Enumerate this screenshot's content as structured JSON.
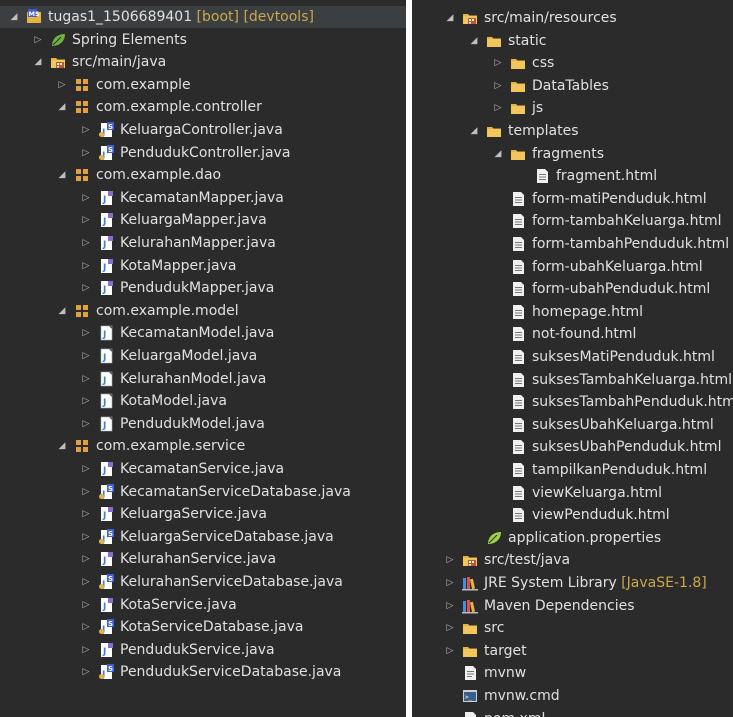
{
  "left_tree": [
    {
      "depth": 0,
      "expanded": true,
      "icon": "maven-project-icon",
      "label": "tugas1_1506689401",
      "decoration": " [boot] [devtools]",
      "row": 0
    },
    {
      "depth": 1,
      "expanded": false,
      "icon": "spring-leaf-icon",
      "label": "Spring Elements",
      "row": 1
    },
    {
      "depth": 1,
      "expanded": true,
      "icon": "source-folder-icon",
      "label": "src/main/java",
      "row": 2
    },
    {
      "depth": 2,
      "expanded": false,
      "icon": "package-icon",
      "label": "com.example",
      "row": 3
    },
    {
      "depth": 2,
      "expanded": true,
      "icon": "package-icon",
      "label": "com.example.controller",
      "row": 4
    },
    {
      "depth": 3,
      "expanded": false,
      "icon": "java-class-spring-icon",
      "label": "KeluargaController.java",
      "row": 5
    },
    {
      "depth": 3,
      "expanded": false,
      "icon": "java-class-spring-icon",
      "label": "PendudukController.java",
      "row": 6
    },
    {
      "depth": 2,
      "expanded": true,
      "icon": "package-icon",
      "label": "com.example.dao",
      "row": 7
    },
    {
      "depth": 3,
      "expanded": false,
      "icon": "java-interface-icon",
      "label": "KecamatanMapper.java",
      "row": 8
    },
    {
      "depth": 3,
      "expanded": false,
      "icon": "java-interface-icon",
      "label": "KeluargaMapper.java",
      "row": 9
    },
    {
      "depth": 3,
      "expanded": false,
      "icon": "java-interface-icon",
      "label": "KelurahanMapper.java",
      "row": 10
    },
    {
      "depth": 3,
      "expanded": false,
      "icon": "java-interface-icon",
      "label": "KotaMapper.java",
      "row": 11
    },
    {
      "depth": 3,
      "expanded": false,
      "icon": "java-interface-icon",
      "label": "PendudukMapper.java",
      "row": 12
    },
    {
      "depth": 2,
      "expanded": true,
      "icon": "package-icon",
      "label": "com.example.model",
      "row": 13
    },
    {
      "depth": 3,
      "expanded": false,
      "icon": "java-file-icon",
      "label": "KecamatanModel.java",
      "row": 14
    },
    {
      "depth": 3,
      "expanded": false,
      "icon": "java-file-icon",
      "label": "KeluargaModel.java",
      "row": 15
    },
    {
      "depth": 3,
      "expanded": false,
      "icon": "java-file-icon",
      "label": "KelurahanModel.java",
      "row": 16
    },
    {
      "depth": 3,
      "expanded": false,
      "icon": "java-file-icon",
      "label": "KotaModel.java",
      "row": 17
    },
    {
      "depth": 3,
      "expanded": false,
      "icon": "java-file-icon",
      "label": "PendudukModel.java",
      "row": 18
    },
    {
      "depth": 2,
      "expanded": true,
      "icon": "package-icon",
      "label": "com.example.service",
      "row": 19
    },
    {
      "depth": 3,
      "expanded": false,
      "icon": "java-interface-icon",
      "label": "KecamatanService.java",
      "row": 20
    },
    {
      "depth": 3,
      "expanded": false,
      "icon": "java-class-spring-icon",
      "label": "KecamatanServiceDatabase.java",
      "row": 21
    },
    {
      "depth": 3,
      "expanded": false,
      "icon": "java-interface-icon",
      "label": "KeluargaService.java",
      "row": 22
    },
    {
      "depth": 3,
      "expanded": false,
      "icon": "java-class-spring-icon",
      "label": "KeluargaServiceDatabase.java",
      "row": 23
    },
    {
      "depth": 3,
      "expanded": false,
      "icon": "java-interface-icon",
      "label": "KelurahanService.java",
      "row": 24
    },
    {
      "depth": 3,
      "expanded": false,
      "icon": "java-class-spring-icon",
      "label": "KelurahanServiceDatabase.java",
      "row": 25
    },
    {
      "depth": 3,
      "expanded": false,
      "icon": "java-interface-icon",
      "label": "KotaService.java",
      "row": 26
    },
    {
      "depth": 3,
      "expanded": false,
      "icon": "java-class-spring-icon",
      "label": "KotaServiceDatabase.java",
      "row": 27
    },
    {
      "depth": 3,
      "expanded": false,
      "icon": "java-interface-icon",
      "label": "PendudukService.java",
      "row": 28
    },
    {
      "depth": 3,
      "expanded": false,
      "icon": "java-class-spring-icon",
      "label": "PendudukServiceDatabase.java",
      "row": 29
    }
  ],
  "right_tree": [
    {
      "depth": 1,
      "expanded": true,
      "icon": "source-folder-icon",
      "label": "src/main/resources",
      "row": 0
    },
    {
      "depth": 2,
      "expanded": true,
      "icon": "folder-icon",
      "label": "static",
      "row": 1
    },
    {
      "depth": 3,
      "expanded": false,
      "icon": "folder-icon",
      "label": "css",
      "row": 2
    },
    {
      "depth": 3,
      "expanded": false,
      "icon": "folder-icon",
      "label": "DataTables",
      "row": 3
    },
    {
      "depth": 3,
      "expanded": false,
      "icon": "folder-icon",
      "label": "js",
      "row": 4
    },
    {
      "depth": 2,
      "expanded": true,
      "icon": "folder-icon",
      "label": "templates",
      "row": 5
    },
    {
      "depth": 3,
      "expanded": true,
      "icon": "folder-icon",
      "label": "fragments",
      "row": 6
    },
    {
      "depth": 4,
      "icon": "html-file-icon",
      "label": "fragment.html",
      "row": 7
    },
    {
      "depth": 3,
      "icon": "html-file-icon",
      "label": "form-matiPenduduk.html",
      "row": 8
    },
    {
      "depth": 3,
      "icon": "html-file-icon",
      "label": "form-tambahKeluarga.html",
      "row": 9
    },
    {
      "depth": 3,
      "icon": "html-file-icon",
      "label": "form-tambahPenduduk.html",
      "row": 10
    },
    {
      "depth": 3,
      "icon": "html-file-icon",
      "label": "form-ubahKeluarga.html",
      "row": 11
    },
    {
      "depth": 3,
      "icon": "html-file-icon",
      "label": "form-ubahPenduduk.html",
      "row": 12
    },
    {
      "depth": 3,
      "icon": "html-file-icon",
      "label": "homepage.html",
      "row": 13
    },
    {
      "depth": 3,
      "icon": "html-file-icon",
      "label": "not-found.html",
      "row": 14
    },
    {
      "depth": 3,
      "icon": "html-file-icon",
      "label": "suksesMatiPenduduk.html",
      "row": 15
    },
    {
      "depth": 3,
      "icon": "html-file-icon",
      "label": "suksesTambahKeluarga.html",
      "row": 16
    },
    {
      "depth": 3,
      "icon": "html-file-icon",
      "label": "suksesTambahPenduduk.html",
      "row": 17
    },
    {
      "depth": 3,
      "icon": "html-file-icon",
      "label": "suksesUbahKeluarga.html",
      "row": 18
    },
    {
      "depth": 3,
      "icon": "html-file-icon",
      "label": "suksesUbahPenduduk.html",
      "row": 19
    },
    {
      "depth": 3,
      "icon": "html-file-icon",
      "label": "tampilkanPenduduk.html",
      "row": 20
    },
    {
      "depth": 3,
      "icon": "html-file-icon",
      "label": "viewKeluarga.html",
      "row": 21
    },
    {
      "depth": 3,
      "icon": "html-file-icon",
      "label": "viewPenduduk.html",
      "row": 22
    },
    {
      "depth": 2,
      "icon": "properties-file-icon",
      "label": "application.properties",
      "row": 23
    },
    {
      "depth": 1,
      "expanded": false,
      "icon": "source-folder-icon",
      "label": "src/test/java",
      "row": 24
    },
    {
      "depth": 1,
      "expanded": false,
      "icon": "library-icon",
      "label": "JRE System Library",
      "decoration": " [JavaSE-1.8]",
      "row": 25
    },
    {
      "depth": 1,
      "expanded": false,
      "icon": "library-icon",
      "label": "Maven Dependencies",
      "row": 26
    },
    {
      "depth": 1,
      "expanded": false,
      "icon": "folder-icon",
      "label": "src",
      "row": 27
    },
    {
      "depth": 1,
      "expanded": false,
      "icon": "folder-icon",
      "label": "target",
      "row": 28
    },
    {
      "depth": 1,
      "icon": "text-file-icon",
      "label": "mvnw",
      "row": 29
    },
    {
      "depth": 1,
      "icon": "cmd-file-icon",
      "label": "mvnw.cmd",
      "row": 30
    },
    {
      "depth": 1,
      "icon": "xml-file-icon",
      "label": "pom.xml",
      "row": 31
    }
  ],
  "colors": {
    "background": "#2b2b2b",
    "text": "#e0e0e0",
    "decoration": "#c9a94c",
    "folder": "#e8b33f",
    "package": "#e0a040",
    "java_file": "#3d7fd6",
    "spring_badge": "#6db33f"
  }
}
